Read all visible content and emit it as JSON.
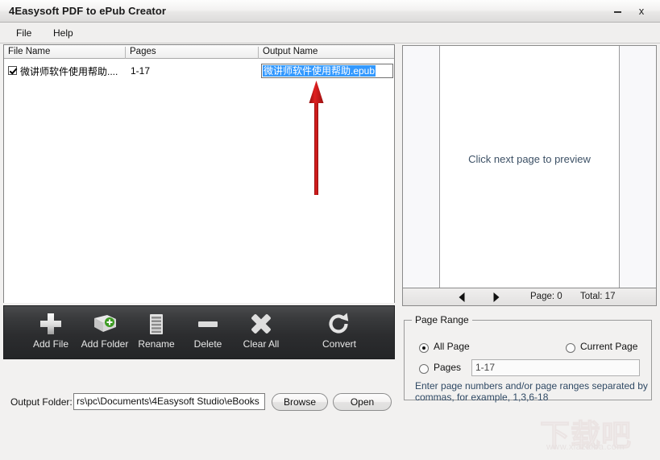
{
  "window": {
    "title": "4Easysoft PDF to ePub Creator",
    "minimize_label": "–",
    "close_label": "x"
  },
  "menu": {
    "items": [
      {
        "label": "File"
      },
      {
        "label": "Help"
      }
    ]
  },
  "file_list": {
    "columns": [
      "File Name",
      "Pages",
      "Output Name"
    ],
    "rows": [
      {
        "checked": true,
        "file_name": "微讲师软件使用帮助....",
        "pages": "1-17",
        "output_name": "微讲师软件使用帮助.epub"
      }
    ]
  },
  "toolbar": {
    "buttons": [
      {
        "label": "Add File",
        "icon": "plus-icon"
      },
      {
        "label": "Add Folder",
        "icon": "folder-add-icon"
      },
      {
        "label": "Rename",
        "icon": "lines-icon"
      },
      {
        "label": "Delete",
        "icon": "minus-icon"
      },
      {
        "label": "Clear All",
        "icon": "cross-icon"
      },
      {
        "label": "Convert",
        "icon": "refresh-icon"
      }
    ]
  },
  "output_folder": {
    "label": "Output Folder:",
    "value": "rs\\pc\\Documents\\4Easysoft Studio\\eBooks",
    "browse_label": "Browse",
    "open_label": "Open"
  },
  "preview": {
    "hint": "Click next page to preview",
    "prev_icon": "triangle-left-icon",
    "next_icon": "triangle-right-icon",
    "page_text": "Page: 0",
    "total_text": "Total: 17"
  },
  "page_range": {
    "legend": "Page Range",
    "all_page_label": "All Page",
    "all_page_selected": true,
    "current_page_label": "Current Page",
    "current_page_selected": false,
    "pages_label": "Pages",
    "pages_selected": false,
    "pages_value": "1-17",
    "hint": "Enter page numbers and/or page ranges separated by commas, for example, 1,3,6-18"
  },
  "annotation": {
    "arrow_color": "#cc1111"
  },
  "watermark": {
    "text_cn": "下载吧",
    "text_url": "www.xiazaiba.com"
  }
}
